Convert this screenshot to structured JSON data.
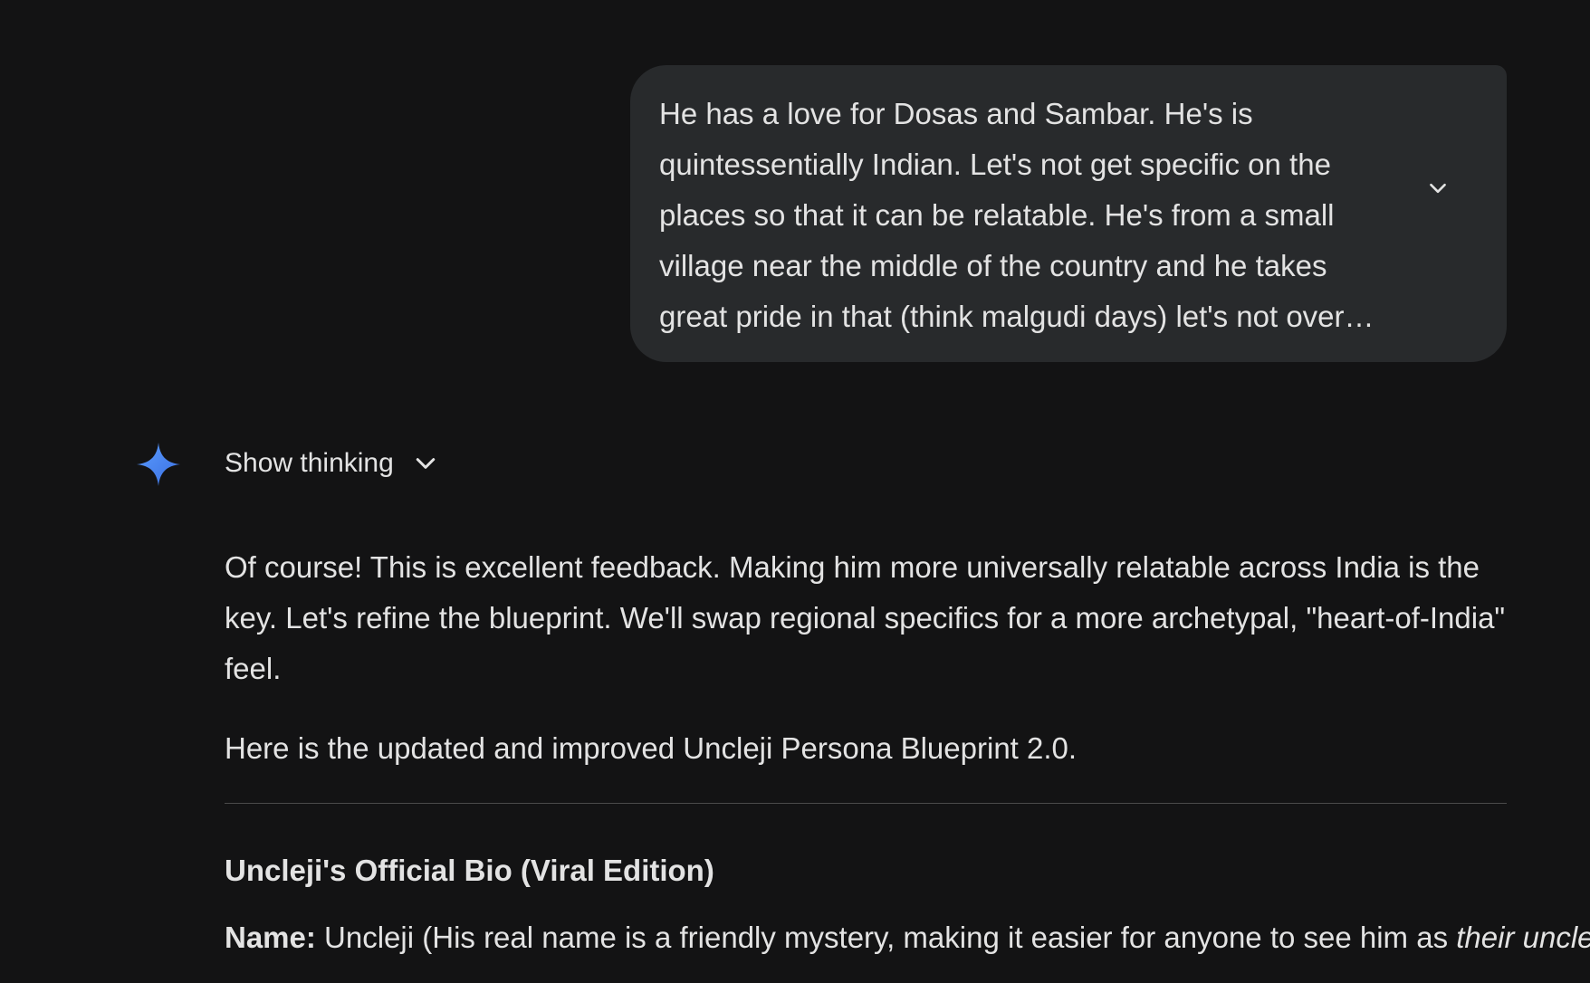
{
  "user_message": {
    "text": "He has a love for Dosas and Sambar. He's is quintessentially Indian. Let's not get specific on the places so that it can be relatable. He's from a small village near the middle of the country and he takes great pride in that (think malgudi days) let's not over index o..."
  },
  "model_response": {
    "icon": "gemini-sparkle-icon",
    "show_thinking_label": "Show thinking",
    "paragraph_1": "Of course! This is excellent feedback. Making him more universally relatable across India is the key. Let's refine the blueprint. We'll swap regional specifics for a more archetypal, \"heart-of-India\" feel.",
    "paragraph_2": "Here is the updated and improved Uncleji Persona Blueprint 2.0.",
    "bio_heading": "Uncleji's Official Bio (Viral Edition)",
    "name_label": "Name:",
    "name_text": " Uncleji (His real name is a friendly mystery, making it easier for anyone to see him as ",
    "name_emphasis": "their uncle)"
  },
  "colors": {
    "background": "#131314",
    "bubble": "#282a2c",
    "text": "#e3e3e3",
    "gemini_blue": "#4f8cf7"
  }
}
